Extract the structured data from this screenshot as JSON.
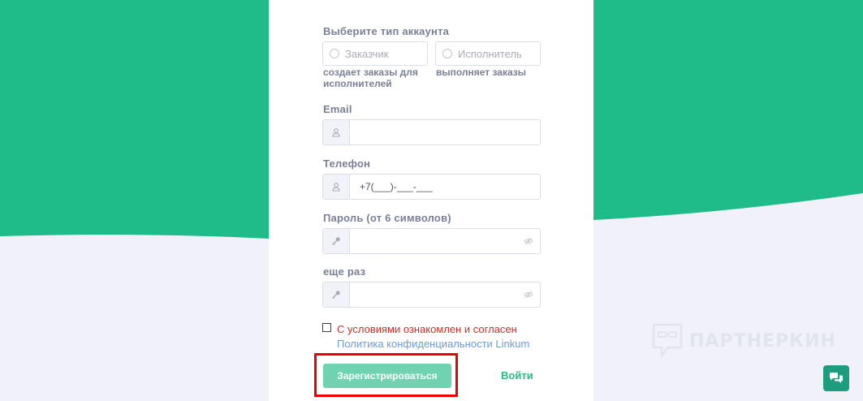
{
  "form": {
    "account_type_label": "Выберите тип аккаунта",
    "customer_option": "Заказчик",
    "customer_desc": "создает заказы для исполнителей",
    "executor_option": "Исполнитель",
    "executor_desc": "выполняет заказы",
    "email_label": "Email",
    "email_value": "",
    "phone_label": "Телефон",
    "phone_value": "+7(___)-___-___",
    "password_label": "Пароль (от 6 символов)",
    "password_value": "",
    "repeat_label": "еще раз",
    "repeat_value": "",
    "agree_text": "С условиями ознакомлен и согласен",
    "policy_link": "Политика конфиденциальности Linkum",
    "register_button": "Зарегистрироваться",
    "login_link": "Войти"
  },
  "watermark": {
    "text": "ПАРТНЕРКИН",
    "icon": "chat-bubble-logo-icon"
  },
  "chat_widget": {
    "icon": "chat-bubbles-icon"
  },
  "colors": {
    "green_band": "#1fbb88",
    "page_background": "#f1f2f9",
    "register_button": "#6fd2b0",
    "login_link": "#2db886",
    "agree_text": "#c5312a",
    "policy_link": "#6c9bd8",
    "highlight": "#ee0000",
    "chat_button": "#1e9c7e"
  }
}
